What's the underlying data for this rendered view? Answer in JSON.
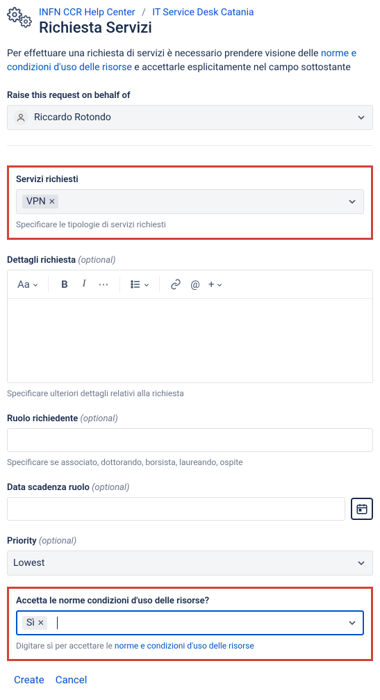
{
  "breadcrumbs": {
    "home": "INFN CCR Help Center",
    "desk": "IT Service Desk Catania"
  },
  "page_title": "Richiesta Servizi",
  "intro_prefix": "Per effettuare una richiesta di servizi è necessario prendere visione delle ",
  "intro_link": "norme e condizioni d'uso delle risorse",
  "intro_suffix": " e accettarle esplicitamente nel campo sottostante",
  "behalf": {
    "label": "Raise this request on behalf of",
    "value": "Riccardo Rotondo"
  },
  "servizi": {
    "label": "Servizi richiesti",
    "value": "VPN",
    "help": "Specificare le tipologie di servizi richiesti"
  },
  "dettagli": {
    "label": "Dettagli richiesta",
    "optional": "(optional)",
    "toolbar": {
      "text_style": "Aa"
    },
    "help": "Specificare ulteriori dettagli relativi alla richiesta"
  },
  "ruolo": {
    "label": "Ruolo richiedente",
    "optional": "(optional)",
    "help": "Specificare se associato, dottorando, borsista, laureando, ospite"
  },
  "scadenza": {
    "label": "Data scadenza ruolo",
    "optional": "(optional)"
  },
  "priority": {
    "label": "Priority",
    "optional": "(optional)",
    "value": "Lowest"
  },
  "accetta": {
    "label": "Accetta le norme condizioni d'uso delle risorse?",
    "value": "Sì",
    "help_prefix": "Digitare sì per accettare le ",
    "help_link": "norme e condizioni d'uso delle risorse"
  },
  "actions": {
    "create": "Create",
    "cancel": "Cancel"
  }
}
